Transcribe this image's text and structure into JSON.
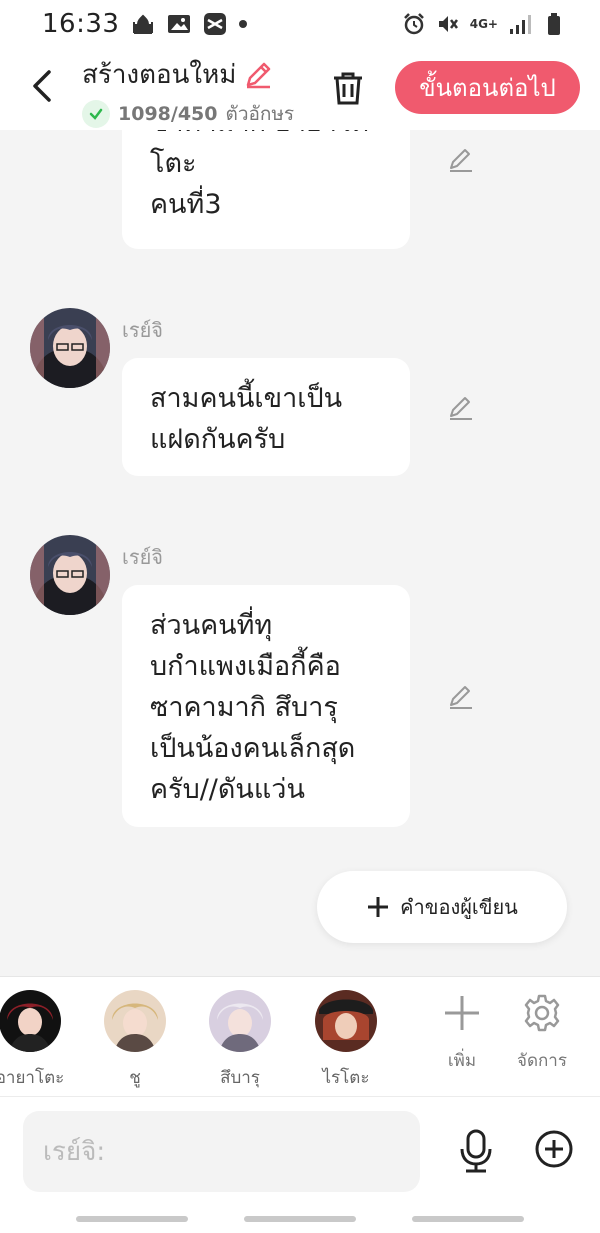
{
  "status_bar": {
    "time": "16:33",
    "network": "4G+",
    "left_icons": [
      "mosque-icon",
      "image-icon",
      "capcut-icon",
      "dot"
    ],
    "right_icons": [
      "alarm-icon",
      "mute-icon",
      "signal-icon",
      "battery-icon"
    ]
  },
  "header": {
    "title": "สร้างตอนใหม่",
    "char_count": "1098/450",
    "char_unit": "ตัวอักษร",
    "next_label": "ขั้นตอนต่อไป"
  },
  "messages": [
    {
      "speaker": "",
      "lines": [
        "ซาคามากิ อายาโต",
        "โตะ",
        "คนที่3"
      ]
    },
    {
      "speaker": "เรย์จิ",
      "lines": [
        "สามคนนี้เขาเป็น",
        "แฝดกันครับ"
      ]
    },
    {
      "speaker": "เรย์จิ",
      "lines": [
        "ส่วนคนที่ทุ",
        "บกำแพงเมือกี้คือ",
        "ซาคามากิ สึบารุ",
        "เป็นน้องคนเล็กสุด",
        "ครับ//ดันแว่น"
      ]
    }
  ],
  "narrator_button": {
    "label": "คำของผู้เขียน"
  },
  "characters": [
    {
      "name": "อายาโตะ"
    },
    {
      "name": "ชู"
    },
    {
      "name": "สึบารุ"
    },
    {
      "name": "ไรโตะ"
    }
  ],
  "tools": {
    "add_label": "เพิ่ม",
    "manage_label": "จัดการ"
  },
  "input": {
    "placeholder": "เรย์จิ:",
    "value": ""
  },
  "colors": {
    "accent": "#f05a6e",
    "check": "#2db84d",
    "icon_gray": "#999999"
  }
}
